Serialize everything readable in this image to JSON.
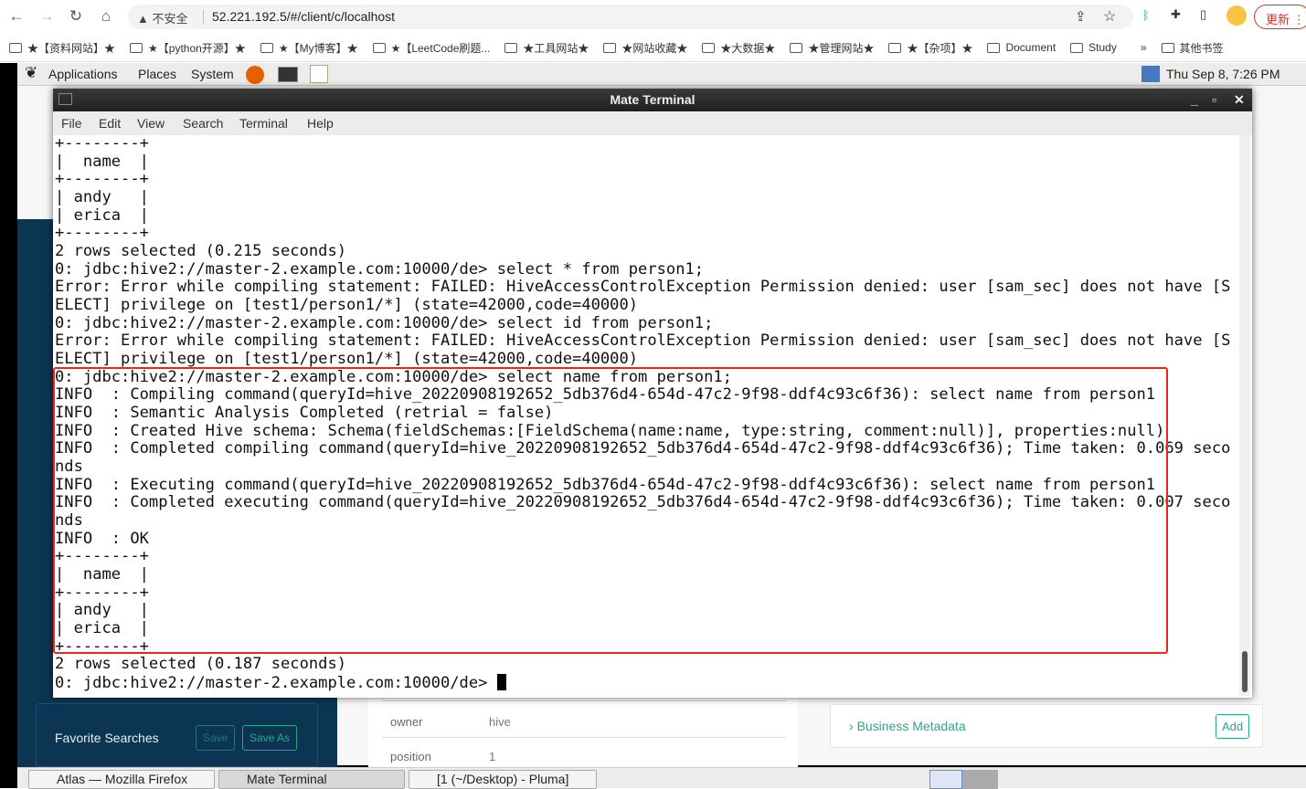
{
  "browser": {
    "security_label": "不安全",
    "url": "52.221.192.5/#/client/c/localhost",
    "update_label": "更新",
    "bookmarks": [
      "★【资料网站】★",
      "★【python开源】★",
      "★【My博客】★",
      "★【LeetCode刷题...",
      "★工具网站★",
      "★网站收藏★",
      "★大数据★",
      "★管理网站★",
      "★【杂项】★",
      "Document",
      "Study"
    ],
    "more_bookmarks": "»",
    "other_bookmarks": "其他书签"
  },
  "desktop_panel": {
    "applications": "Applications",
    "places": "Places",
    "system": "System",
    "clock": "Thu Sep  8,  7:26 PM"
  },
  "terminal": {
    "title": "Mate Terminal",
    "menu": [
      "File",
      "Edit",
      "View",
      "Search",
      "Terminal",
      "Help"
    ],
    "lines": [
      "+--------+",
      "|  name  |",
      "+--------+",
      "| andy   |",
      "| erica  |",
      "+--------+",
      "2 rows selected (0.215 seconds)",
      "0: jdbc:hive2://master-2.example.com:10000/de> select * from person1;",
      "Error: Error while compiling statement: FAILED: HiveAccessControlException Permission denied: user [sam_sec] does not have [S",
      "ELECT] privilege on [test1/person1/*] (state=42000,code=40000)",
      "0: jdbc:hive2://master-2.example.com:10000/de> select id from person1;",
      "Error: Error while compiling statement: FAILED: HiveAccessControlException Permission denied: user [sam_sec] does not have [S",
      "ELECT] privilege on [test1/person1/*] (state=42000,code=40000)",
      "0: jdbc:hive2://master-2.example.com:10000/de> select name from person1;",
      "INFO  : Compiling command(queryId=hive_20220908192652_5db376d4-654d-47c2-9f98-ddf4c93c6f36): select name from person1",
      "INFO  : Semantic Analysis Completed (retrial = false)",
      "INFO  : Created Hive schema: Schema(fieldSchemas:[FieldSchema(name:name, type:string, comment:null)], properties:null)",
      "INFO  : Completed compiling command(queryId=hive_20220908192652_5db376d4-654d-47c2-9f98-ddf4c93c6f36); Time taken: 0.069 seco",
      "nds",
      "INFO  : Executing command(queryId=hive_20220908192652_5db376d4-654d-47c2-9f98-ddf4c93c6f36): select name from person1",
      "INFO  : Completed executing command(queryId=hive_20220908192652_5db376d4-654d-47c2-9f98-ddf4c93c6f36); Time taken: 0.007 seco",
      "nds",
      "INFO  : OK",
      "+--------+",
      "|  name  |",
      "+--------+",
      "| andy   |",
      "| erica  |",
      "+--------+",
      "2 rows selected (0.187 seconds)"
    ],
    "prompt": "0: jdbc:hive2://master-2.example.com:10000/de> ",
    "highlight_color": "#e8261a"
  },
  "atlas": {
    "favorite_searches": "Favorite Searches",
    "save": "Save",
    "save_as": "Save As",
    "props": [
      {
        "key": "owner",
        "value": "hive"
      },
      {
        "key": "position",
        "value": "1"
      }
    ],
    "business_metadata": "Business Metadata",
    "add": "Add"
  },
  "taskbar": [
    "Atlas — Mozilla Firefox",
    "Mate Terminal",
    "[1 (~/Desktop) - Pluma]"
  ]
}
